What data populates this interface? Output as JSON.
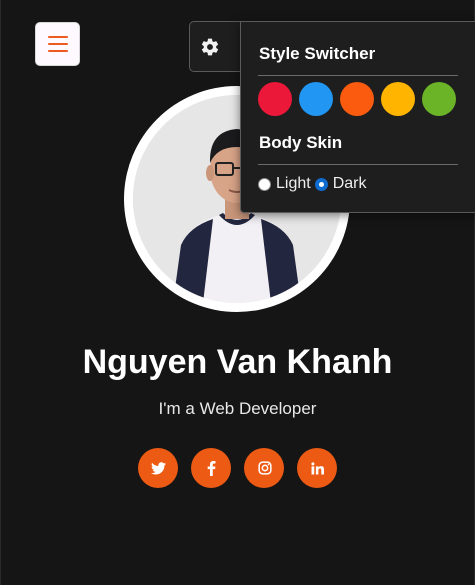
{
  "nav": {
    "menu_icon": "hamburger-icon"
  },
  "profile": {
    "name": "Nguyen Van Khanh",
    "role": "I'm a Web Developer",
    "photo_icon": "profile-photo"
  },
  "socials": [
    {
      "name": "twitter",
      "icon": "twitter-icon"
    },
    {
      "name": "facebook",
      "icon": "facebook-icon"
    },
    {
      "name": "instagram",
      "icon": "instagram-icon"
    },
    {
      "name": "linkedin",
      "icon": "linkedin-icon"
    }
  ],
  "style_switcher": {
    "toggle_icon": "gear-icon",
    "title": "Style Switcher",
    "colors": [
      "#ec1839",
      "#2196f3",
      "#fa5b0f",
      "#ffb400",
      "#6bb327"
    ],
    "skin_title": "Body Skin",
    "skins": [
      {
        "label": "Light",
        "checked": false
      },
      {
        "label": "Dark",
        "checked": true
      }
    ]
  },
  "theme": {
    "accent": "#ec5a14",
    "background": "#151515",
    "panel": "#1e1e1e"
  }
}
